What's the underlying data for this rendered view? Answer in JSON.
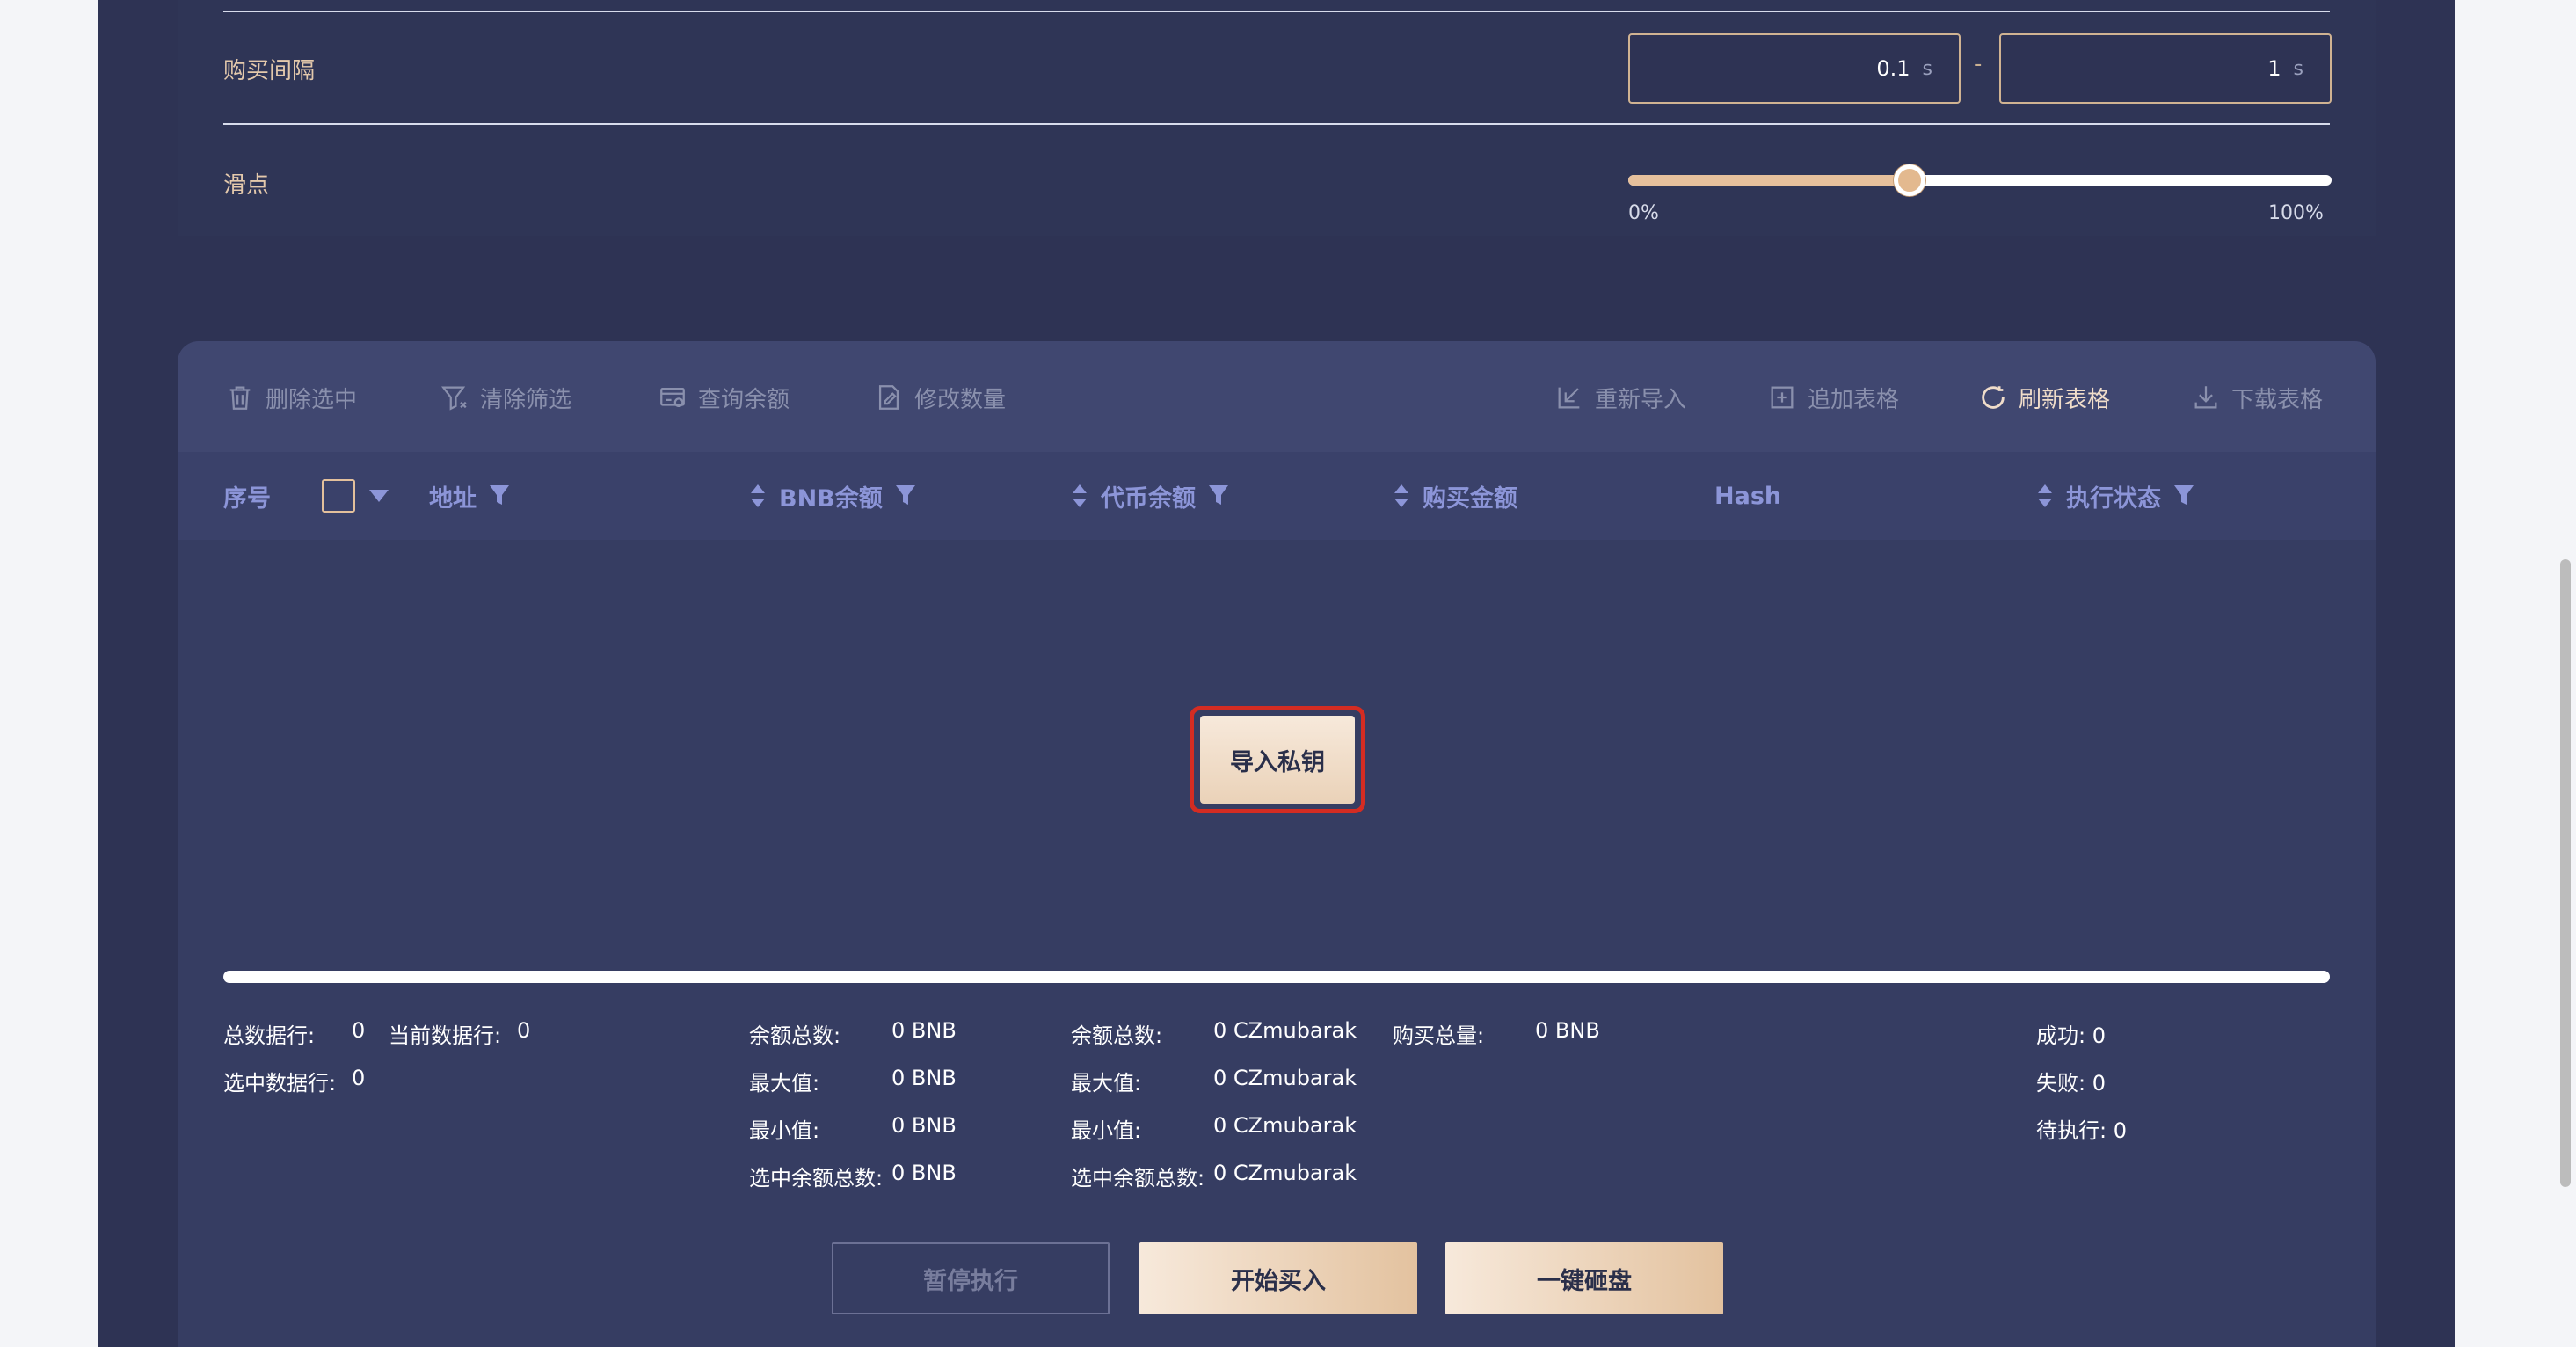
{
  "settings": {
    "interval_label": "购买间隔",
    "interval_min": "0.1",
    "interval_max": "1",
    "interval_unit": "s",
    "interval_separator": "-",
    "slippage_label": "滑点",
    "slippage_min_label": "0%",
    "slippage_max_label": "100%",
    "slippage_value_percent": 40
  },
  "toolbar": {
    "delete_selected": "删除选中",
    "clear_filter": "清除筛选",
    "query_balance": "查询余额",
    "modify_quantity": "修改数量",
    "reimport": "重新导入",
    "append_table": "追加表格",
    "refresh_table": "刷新表格",
    "download_table": "下载表格"
  },
  "table": {
    "columns": {
      "index": "序号",
      "address": "地址",
      "bnb_balance": "BNB余额",
      "token_balance": "代币余额",
      "buy_amount": "购买金额",
      "hash": "Hash",
      "status": "执行状态"
    },
    "import_button": "导入私钥"
  },
  "stats": {
    "total_rows_label": "总数据行:",
    "total_rows": "0",
    "current_rows_label": "当前数据行:",
    "current_rows": "0",
    "selected_rows_label": "选中数据行:",
    "selected_rows": "0",
    "bnb": {
      "total_label": "余额总数:",
      "total": "0 BNB",
      "max_label": "最大值:",
      "max": "0 BNB",
      "min_label": "最小值:",
      "min": "0 BNB",
      "selected_total_label": "选中余额总数:",
      "selected_total": "0 BNB"
    },
    "token": {
      "total_label": "余额总数:",
      "total": "0 CZmubarak",
      "max_label": "最大值:",
      "max": "0 CZmubarak",
      "min_label": "最小值:",
      "min": "0 CZmubarak",
      "selected_total_label": "选中余额总数:",
      "selected_total": "0 CZmubarak"
    },
    "buy_total_label": "购买总量:",
    "buy_total": "0 BNB",
    "success": "成功: 0",
    "failed": "失败: 0",
    "pending": "待执行: 0"
  },
  "actions": {
    "pause": "暂停执行",
    "start_buy": "开始买入",
    "dump": "一键砸盘"
  },
  "colors": {
    "background": "#2e3354",
    "accent": "#e3c29f",
    "header_text": "#8c95d8",
    "highlight": "#d42c22"
  }
}
